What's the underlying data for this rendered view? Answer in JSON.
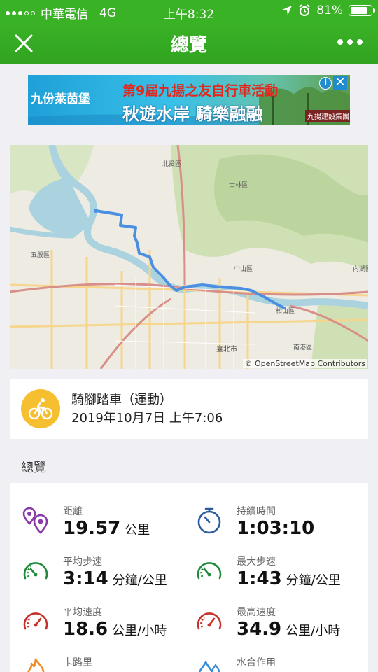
{
  "status_bar": {
    "carrier": "中華電信",
    "network": "4G",
    "time": "上午8:32",
    "battery_percent": "81%",
    "battery_level": 0.81
  },
  "nav": {
    "title": "總覽"
  },
  "ad": {
    "logo_text": "九份萊茵堡",
    "headline": "第9屆九揚之友自行車活動",
    "tagline": "秋遊水岸 騎樂融融",
    "organizer": "九揚建設集團",
    "colors": {
      "headline": "#e0281f",
      "background": "#1fa0d8"
    }
  },
  "map": {
    "attribution": "© OpenStreetMap Contributors",
    "labels": {
      "beitou": "北投區",
      "shilin": "士林區",
      "wugu": "五股區",
      "taipei_city": "臺北市",
      "zhongshan": "中山區",
      "songshan": "松山區",
      "neihu": "內湖區",
      "nangang": "南港區"
    },
    "route_color": "#4a8fe2"
  },
  "activity": {
    "name": "騎腳踏車（運動）",
    "datetime": "2019年10月7日 上午7:06",
    "icon": "bicycle-icon",
    "icon_color": "#f6bf2f"
  },
  "section": {
    "overview_label": "總覽"
  },
  "stats": {
    "distance": {
      "label": "距離",
      "value": "19.57",
      "unit": "公里"
    },
    "duration": {
      "label": "持續時間",
      "value": "1:03:10"
    },
    "avg_pace": {
      "label": "平均步速",
      "value": "3:14",
      "unit": "分鐘/公里"
    },
    "max_pace": {
      "label": "最大步速",
      "value": "1:43",
      "unit": "分鐘/公里"
    },
    "avg_speed": {
      "label": "平均速度",
      "value": "18.6",
      "unit": "公里/小時"
    },
    "max_speed": {
      "label": "最高速度",
      "value": "34.9",
      "unit": "公里/小時"
    },
    "calories": {
      "label": "卡路里"
    },
    "hydration": {
      "label": "水合作用"
    }
  },
  "colors": {
    "brand_green": "#3ab226",
    "pace_green": "#1f8a3a",
    "speed_red": "#c8302a",
    "distance_purple": "#8a3aa8",
    "duration_blue": "#2c5c9c",
    "calorie_orange": "#f08a24",
    "hydration_blue": "#3a8ed8"
  }
}
